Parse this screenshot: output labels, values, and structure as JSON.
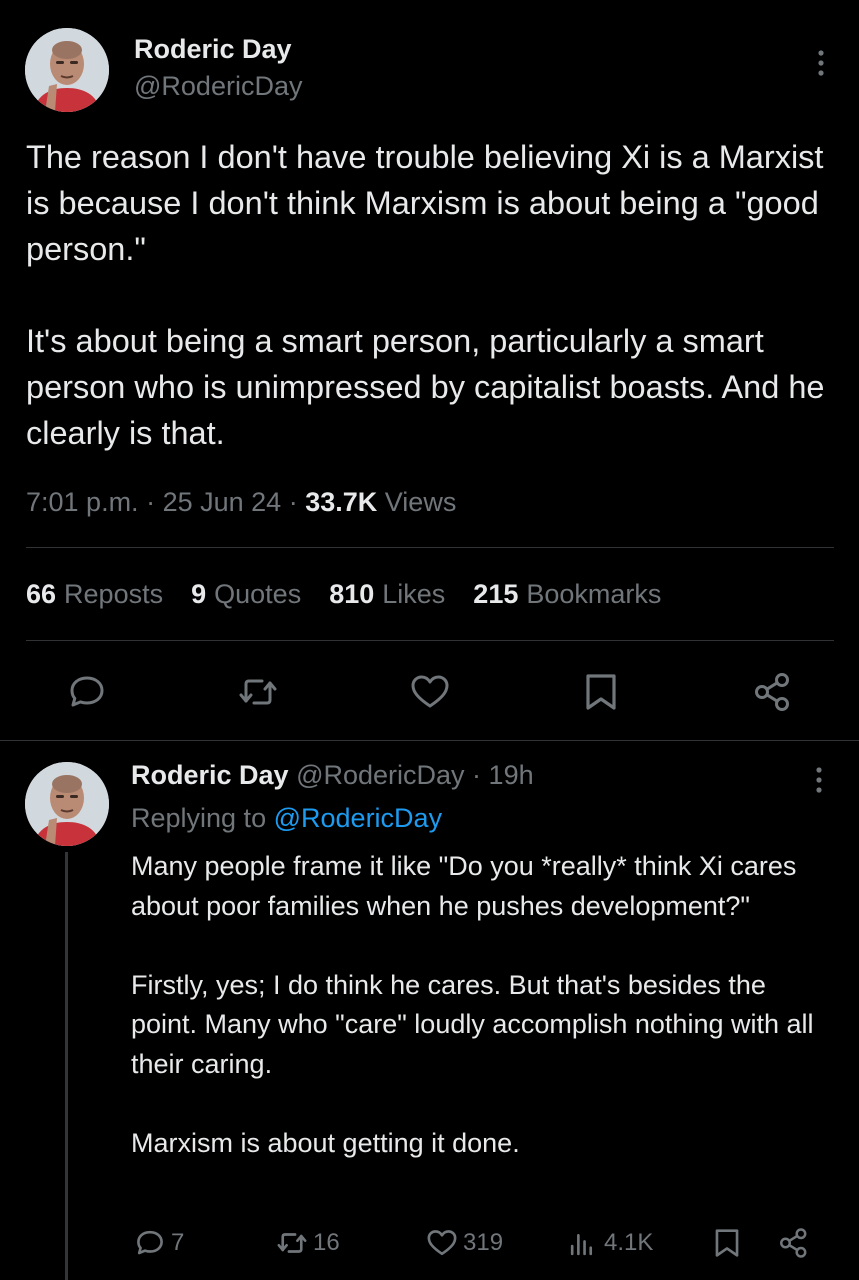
{
  "tweet": {
    "author_name": "Roderic Day",
    "author_handle": "@RodericDay",
    "paragraphs": [
      "The reason I don't have trouble believing Xi is a Marxist is because I don't think Marxism is about being a \"good person.\"",
      "It's about being a smart person, particularly a smart person who is unimpressed by capitalist boasts. And he clearly is that."
    ],
    "time": "7:01 p.m.",
    "date": "25 Jun 24",
    "views_count": "33.7K",
    "views_label": "Views",
    "stats": {
      "reposts_count": "66",
      "reposts_label": "Reposts",
      "quotes_count": "9",
      "quotes_label": "Quotes",
      "likes_count": "810",
      "likes_label": "Likes",
      "bookmarks_count": "215",
      "bookmarks_label": "Bookmarks"
    }
  },
  "reply": {
    "author_name": "Roderic Day",
    "author_handle": "@RodericDay",
    "age": "19h",
    "replying_prefix": "Replying to",
    "replying_to": "@RodericDay",
    "paragraphs": [
      "Many people frame it like \"Do you *really* think Xi cares about poor families when he pushes development?\"",
      "Firstly, yes; I do think he cares. But that's besides the point. Many who \"care\" loudly accomplish nothing with all their caring.",
      "Marxism is about getting it done."
    ],
    "counts": {
      "replies": "7",
      "reposts": "16",
      "likes": "319",
      "views": "4.1K"
    }
  },
  "icons": {
    "more": "more-vertical-icon",
    "reply": "speech-bubble-icon",
    "repost": "repost-arrows-icon",
    "like": "heart-icon",
    "bookmark": "bookmark-icon",
    "share": "share-nodes-icon",
    "views": "bar-chart-icon"
  },
  "colors": {
    "background": "#000000",
    "text": "#e7e9ea",
    "muted": "#71767b",
    "link": "#1d9bf0",
    "divider": "#2f3336"
  }
}
